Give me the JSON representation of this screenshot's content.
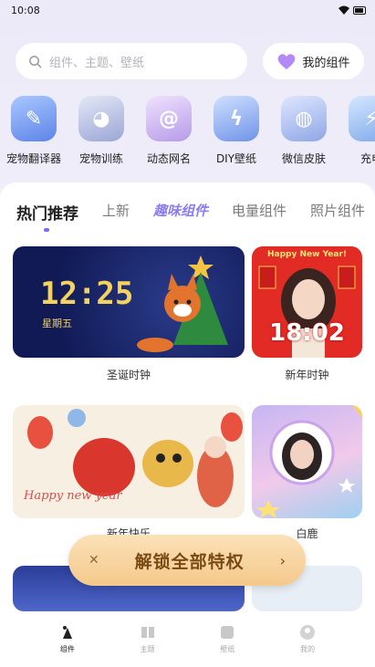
{
  "status": {
    "time": "10:08"
  },
  "search": {
    "placeholder": "组件、主题、壁纸"
  },
  "my_widgets": {
    "label": "我的组件"
  },
  "categories": [
    {
      "label": "宠物翻译器",
      "icon": "pet-translator-icon",
      "color": "#7aa6f0"
    },
    {
      "label": "宠物训练",
      "icon": "cat-face-icon",
      "color": "#b9c3e6"
    },
    {
      "label": "动态网名",
      "icon": "at-sign-icon",
      "color": "#c9b3ee"
    },
    {
      "label": "DIY壁纸",
      "icon": "lightning-icon",
      "color": "#8fb4ef"
    },
    {
      "label": "微信皮肤",
      "icon": "chat-bubble-icon",
      "color": "#a9bde8"
    },
    {
      "label": "充电",
      "icon": "charge-icon",
      "color": "#9cc0ef"
    }
  ],
  "tabs": [
    {
      "label": "热门推荐",
      "active": true
    },
    {
      "label": "上新",
      "active": false
    },
    {
      "label": "趣味组件",
      "active": false
    },
    {
      "label": "电量组件",
      "active": false
    },
    {
      "label": "照片组件",
      "active": false
    }
  ],
  "cards": {
    "xmas": {
      "time": "12:25",
      "day": "星期五",
      "label": "圣诞时钟"
    },
    "new_year": {
      "header": "Happy New Year!",
      "time": "18:02",
      "label": "新年时钟"
    },
    "happy": {
      "art_text": "Happy new year",
      "label": "新年快乐"
    },
    "deer": {
      "label": "白鹿"
    }
  },
  "unlock": {
    "label": "解锁全部特权"
  },
  "nav": [
    {
      "label": "组件",
      "active": true
    },
    {
      "label": "主题",
      "active": false
    },
    {
      "label": "壁纸",
      "active": false
    },
    {
      "label": "我的",
      "active": false
    }
  ],
  "colors": {
    "accent": "#7b6cf5",
    "banner": "#f5c98c"
  }
}
